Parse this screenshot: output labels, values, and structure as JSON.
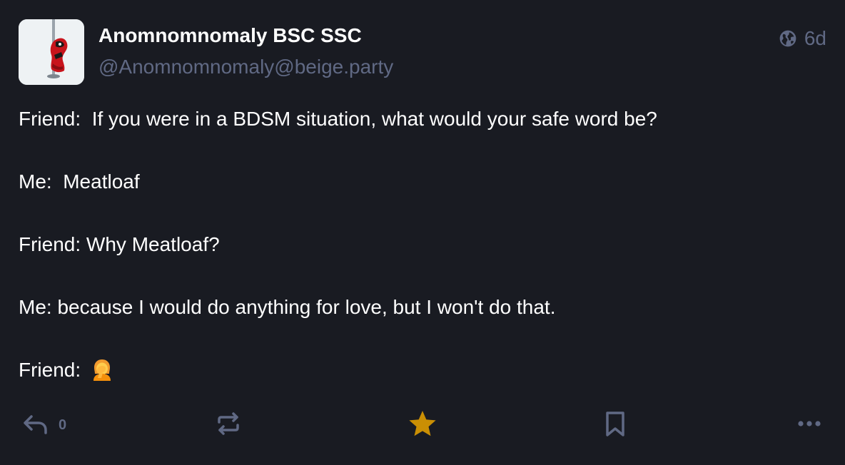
{
  "post": {
    "display_name": "Anomnomnomaly BSC SSC",
    "handle": "@Anomnomnomaly@beige.party",
    "visibility_icon": "globe-icon",
    "timestamp": "6d",
    "avatar_icon": "deadpool-pole-avatar",
    "lines": [
      "Friend:  If you were in a BDSM situation, what would your safe word be?",
      "Me:  Meatloaf",
      "Friend: Why Meatloaf?",
      "Me: because I would do anything for love, but I won't do that.",
      "Friend: "
    ],
    "final_emoji": "person-facepalming-emoji"
  },
  "actions": {
    "reply_icon": "reply-icon",
    "reply_count": "0",
    "boost_icon": "boost-icon",
    "favourite_icon": "star-icon",
    "bookmark_icon": "bookmark-icon",
    "more_icon": "more-icon"
  },
  "colors": {
    "background": "#191b22",
    "text": "#ffffff",
    "muted": "#606984",
    "favourite_active": "#ca8f04"
  }
}
